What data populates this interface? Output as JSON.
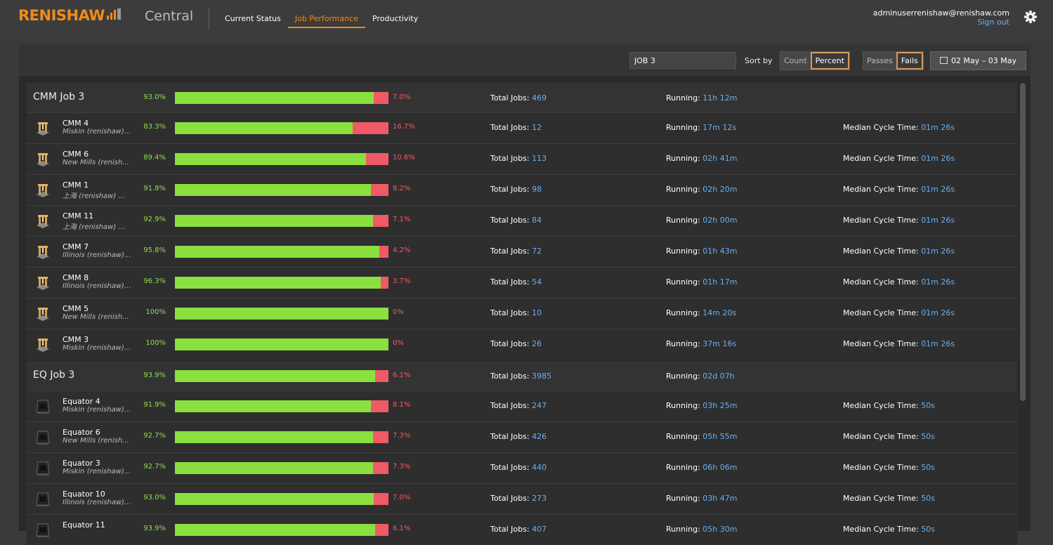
{
  "header": {
    "brand": "RENISHAW",
    "app_title": "Central",
    "nav": [
      {
        "label": "Current Status",
        "active": false
      },
      {
        "label": "Job Performance",
        "active": true
      },
      {
        "label": "Productivity",
        "active": false
      }
    ],
    "user_email": "adminuserrenishaw@renishaw.com",
    "sign_out": "Sign out"
  },
  "toolbar": {
    "job_filter_value": "JOB 3",
    "sort_by_label": "Sort by",
    "sort_options": [
      "Count",
      "Percent"
    ],
    "sort_selected": "Percent",
    "result_options": [
      "Passes",
      "Fails"
    ],
    "result_selected": "Fails",
    "date_range": "02 May – 03 May"
  },
  "labels": {
    "total_jobs": "Total Jobs: ",
    "running": "Running: ",
    "median_cycle": "Median Cycle Time: "
  },
  "colors": {
    "accent": "#f08a1c",
    "pass": "#8be040",
    "fail": "#f05a66",
    "value": "#6ab0f0"
  },
  "groups": [
    {
      "title": "CMM Job 3",
      "pass_pct": "93.0%",
      "pass_fraction": 0.93,
      "fail_pct": "7.0%",
      "total_jobs": "469",
      "running": "11h 12m",
      "machines": [
        {
          "icon": "cmm-machine-icon",
          "name": "CMM 4",
          "location": "Miskin (renishaw)...",
          "pass_pct": "83.3%",
          "pass_fraction": 0.833,
          "fail_pct": "16.7%",
          "total_jobs": "12",
          "running": "17m 12s",
          "median_cycle": "01m 26s"
        },
        {
          "icon": "cmm-machine-icon",
          "name": "CMM 6",
          "location": "New Mills (renish...",
          "pass_pct": "89.4%",
          "pass_fraction": 0.894,
          "fail_pct": "10.6%",
          "total_jobs": "113",
          "running": "02h 41m",
          "median_cycle": "01m 26s"
        },
        {
          "icon": "cmm-machine-icon",
          "name": "CMM 1",
          "location": "上海 (renishaw) ...",
          "pass_pct": "91.8%",
          "pass_fraction": 0.918,
          "fail_pct": "8.2%",
          "total_jobs": "98",
          "running": "02h 20m",
          "median_cycle": "01m 26s"
        },
        {
          "icon": "cmm-machine-icon",
          "name": "CMM 11",
          "location": "上海 (renishaw) ...",
          "pass_pct": "92.9%",
          "pass_fraction": 0.929,
          "fail_pct": "7.1%",
          "total_jobs": "84",
          "running": "02h 00m",
          "median_cycle": "01m 26s"
        },
        {
          "icon": "cmm-machine-icon",
          "name": "CMM 7",
          "location": "Illinois (renishaw)...",
          "pass_pct": "95.8%",
          "pass_fraction": 0.958,
          "fail_pct": "4.2%",
          "total_jobs": "72",
          "running": "01h 43m",
          "median_cycle": "01m 26s"
        },
        {
          "icon": "cmm-machine-icon",
          "name": "CMM 8",
          "location": "Illinois (renishaw)...",
          "pass_pct": "96.3%",
          "pass_fraction": 0.963,
          "fail_pct": "3.7%",
          "total_jobs": "54",
          "running": "01h 17m",
          "median_cycle": "01m 26s"
        },
        {
          "icon": "cmm-machine-icon",
          "name": "CMM 5",
          "location": "New Mills (renish...",
          "pass_pct": "100%",
          "pass_fraction": 1.0,
          "fail_pct": "0%",
          "total_jobs": "10",
          "running": "14m 20s",
          "median_cycle": "01m 26s"
        },
        {
          "icon": "cmm-machine-icon",
          "name": "CMM 3",
          "location": "Miskin (renishaw)...",
          "pass_pct": "100%",
          "pass_fraction": 1.0,
          "fail_pct": "0%",
          "total_jobs": "26",
          "running": "37m 16s",
          "median_cycle": "01m 26s"
        }
      ]
    },
    {
      "title": "EQ Job 3",
      "pass_pct": "93.9%",
      "pass_fraction": 0.939,
      "fail_pct": "6.1%",
      "total_jobs": "3985",
      "running": "02d 07h",
      "machines": [
        {
          "icon": "equator-machine-icon",
          "name": "Equator 4",
          "location": "Miskin (renishaw)...",
          "pass_pct": "91.9%",
          "pass_fraction": 0.919,
          "fail_pct": "8.1%",
          "total_jobs": "247",
          "running": "03h 25m",
          "median_cycle": "50s"
        },
        {
          "icon": "equator-machine-icon",
          "name": "Equator 6",
          "location": "New Mills (renish...",
          "pass_pct": "92.7%",
          "pass_fraction": 0.927,
          "fail_pct": "7.3%",
          "total_jobs": "426",
          "running": "05h 55m",
          "median_cycle": "50s"
        },
        {
          "icon": "equator-machine-icon",
          "name": "Equator 3",
          "location": "Miskin (renishaw)...",
          "pass_pct": "92.7%",
          "pass_fraction": 0.927,
          "fail_pct": "7.3%",
          "total_jobs": "440",
          "running": "06h 06m",
          "median_cycle": "50s"
        },
        {
          "icon": "equator-machine-icon",
          "name": "Equator 10",
          "location": "Illinois (renishaw)...",
          "pass_pct": "93.0%",
          "pass_fraction": 0.93,
          "fail_pct": "7.0%",
          "total_jobs": "273",
          "running": "03h 47m",
          "median_cycle": "50s"
        },
        {
          "icon": "equator-machine-icon",
          "name": "Equator 11",
          "location": "",
          "pass_pct": "93.9%",
          "pass_fraction": 0.939,
          "fail_pct": "6.1%",
          "total_jobs": "407",
          "running": "05h 30m",
          "median_cycle": "50s"
        }
      ]
    }
  ]
}
